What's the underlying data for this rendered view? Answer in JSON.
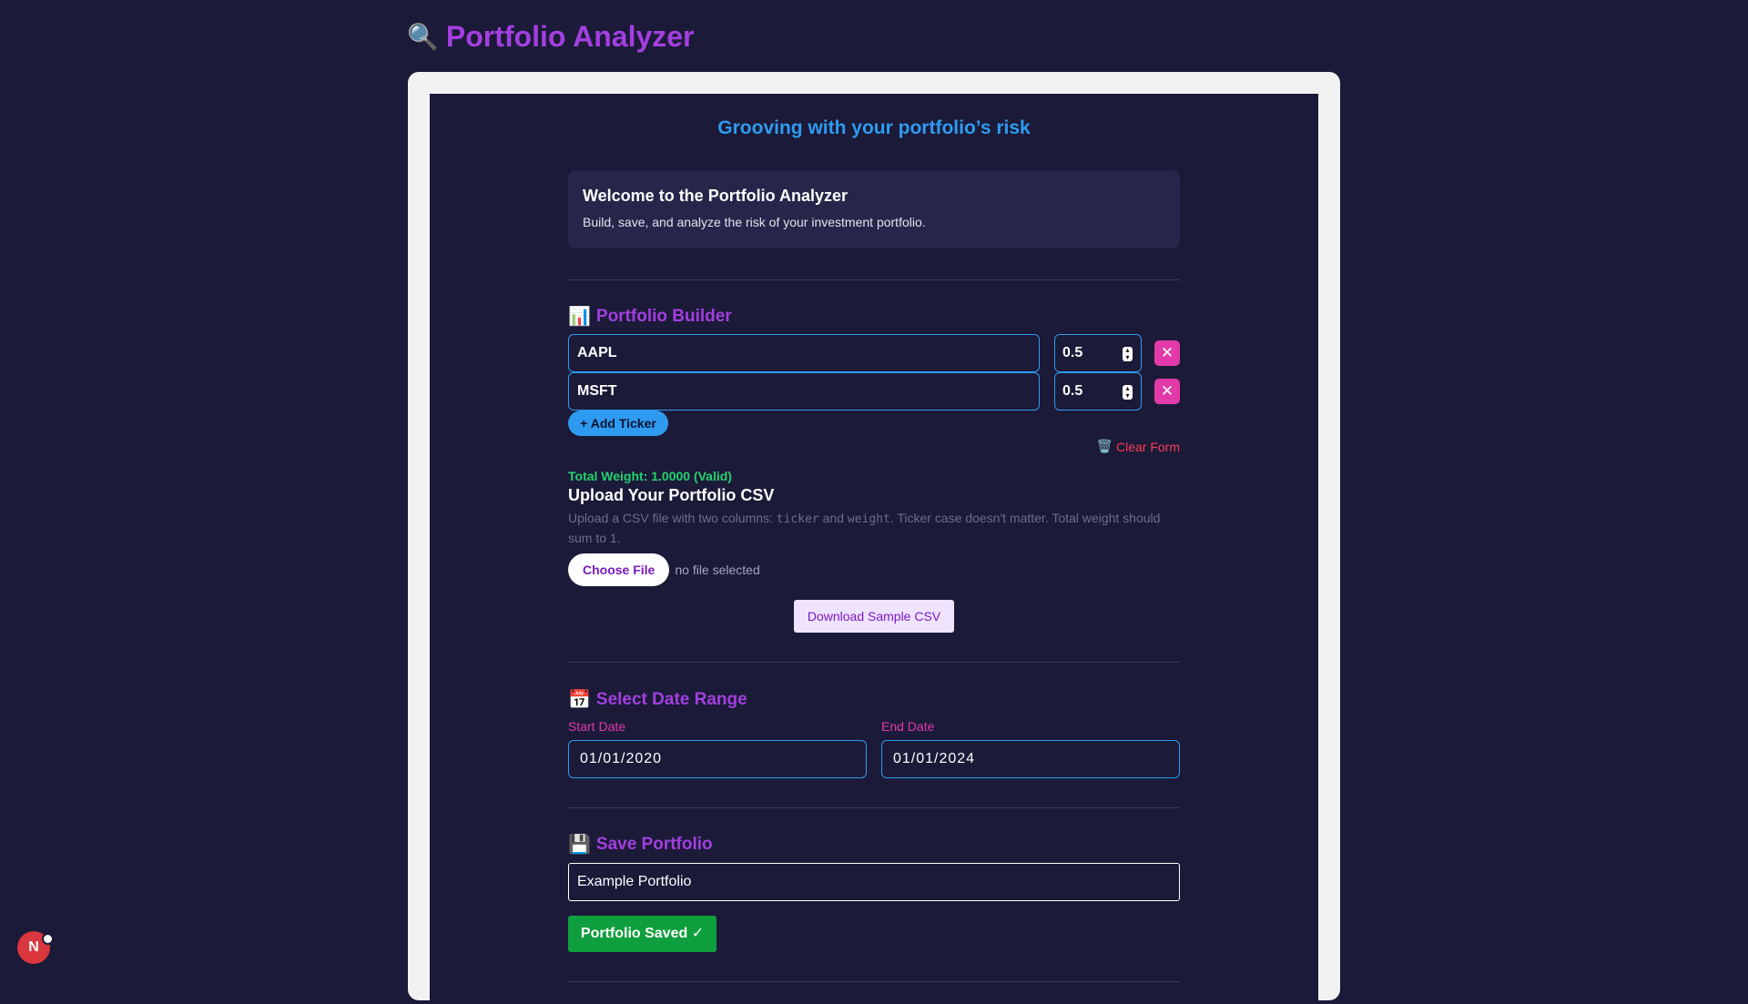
{
  "app": {
    "title": "Portfolio Analyzer",
    "title_icon": "🔍"
  },
  "tagline": "Grooving with your portfolio’s risk",
  "welcome": {
    "title": "Welcome to the Portfolio Analyzer",
    "description": "Build, save, and analyze the risk of your investment portfolio."
  },
  "builder": {
    "title": "Portfolio Builder",
    "icon": "📊",
    "rows": [
      {
        "ticker": "AAPL",
        "weight": "0.5",
        "remove": "✕"
      },
      {
        "ticker": "MSFT",
        "weight": "0.5",
        "remove": "✕"
      }
    ],
    "add_ticker_label": "+ Add Ticker",
    "clear_form_icon": "🗑️",
    "clear_form_label": "Clear Form",
    "total_weight": "Total Weight: 1.0000 (Valid)"
  },
  "upload": {
    "title": "Upload Your Portfolio CSV",
    "desc_pre": "Upload a CSV file with two columns: ",
    "code_ticker": "ticker",
    "desc_and": " and ",
    "code_weight": "weight",
    "desc_post": ". Ticker case doesn't matter. Total weight should sum to 1.",
    "choose_file_label": "Choose File",
    "no_file_label": "no file selected",
    "sample_label": "Download Sample CSV"
  },
  "dates": {
    "title": "Select Date Range",
    "icon": "📅",
    "start_label": "Start Date",
    "start_value": "01/01/2020",
    "end_label": "End Date",
    "end_value": "01/01/2024"
  },
  "save": {
    "title": "Save Portfolio",
    "icon": "💾",
    "name_value": "Example Portfolio",
    "saved_label": "Portfolio Saved ✓"
  },
  "avatar": {
    "initial": "N"
  },
  "colors": {
    "background": "#1b1a38",
    "accent_purple": "#a33fe0",
    "accent_blue": "#2f9bf0",
    "accent_pink": "#e23aa8",
    "success_green": "#0f9e3d",
    "danger_red": "#ff3b55"
  }
}
